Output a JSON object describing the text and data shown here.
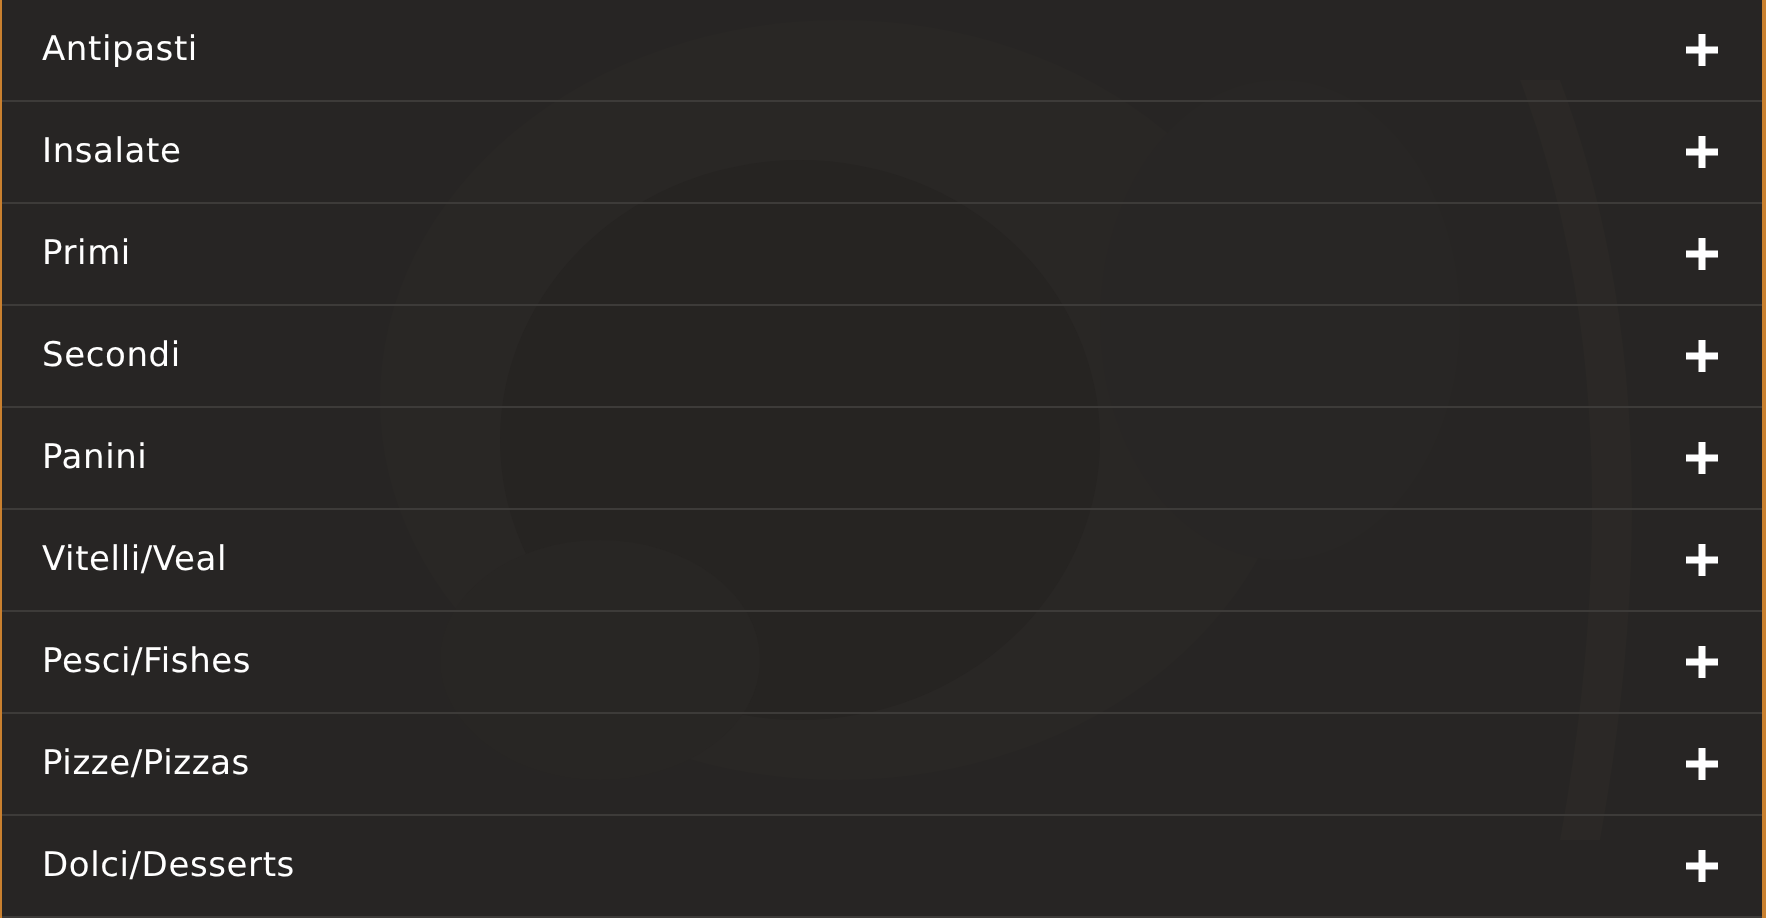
{
  "accordion": {
    "items": [
      {
        "label": "Antipasti",
        "expanded": false
      },
      {
        "label": "Insalate",
        "expanded": false
      },
      {
        "label": "Primi",
        "expanded": false
      },
      {
        "label": "Secondi",
        "expanded": false
      },
      {
        "label": "Panini",
        "expanded": false
      },
      {
        "label": "Vitelli/Veal",
        "expanded": false
      },
      {
        "label": "Pesci/Fishes",
        "expanded": false
      },
      {
        "label": "Pizze/Pizzas",
        "expanded": false
      },
      {
        "label": "Dolci/Desserts",
        "expanded": false
      }
    ]
  }
}
